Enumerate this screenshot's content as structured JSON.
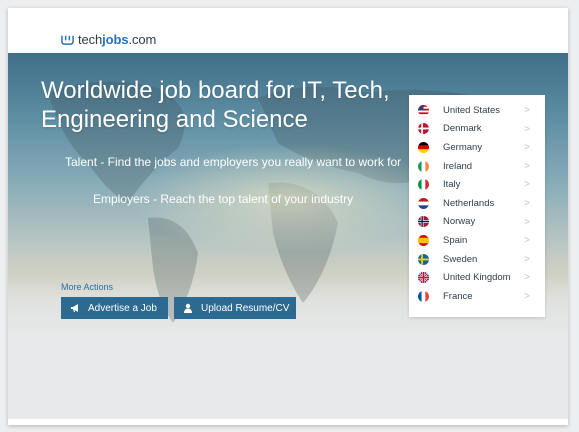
{
  "header": {
    "logo_prefix": "tech",
    "logo_bold": "jobs",
    "logo_suffix": ".com"
  },
  "hero": {
    "title": "Worldwide job board for IT, Tech, Engineering and Science",
    "line1": "Talent - Find the jobs and employers you really want to work for",
    "line2": "Employers - Reach the top talent of your industry"
  },
  "actions": {
    "label": "More Actions",
    "advertise": "Advertise a Job",
    "upload": "Upload Resume/CV"
  },
  "countries": [
    {
      "name": "United States",
      "flag": "us-flag-icon"
    },
    {
      "name": "Denmark",
      "flag": "dk-flag-icon"
    },
    {
      "name": "Germany",
      "flag": "de-flag-icon"
    },
    {
      "name": "Ireland",
      "flag": "ie-flag-icon"
    },
    {
      "name": "Italy",
      "flag": "it-flag-icon"
    },
    {
      "name": "Netherlands",
      "flag": "nl-flag-icon"
    },
    {
      "name": "Norway",
      "flag": "no-flag-icon"
    },
    {
      "name": "Spain",
      "flag": "es-flag-icon"
    },
    {
      "name": "Sweden",
      "flag": "se-flag-icon"
    },
    {
      "name": "United Kingdom",
      "flag": "gb-flag-icon"
    },
    {
      "name": "France",
      "flag": "fr-flag-icon"
    }
  ],
  "colors": {
    "brand_blue": "#2a73b8",
    "button_blue": "#2d6a92",
    "text_dark": "#2d3e4a"
  }
}
